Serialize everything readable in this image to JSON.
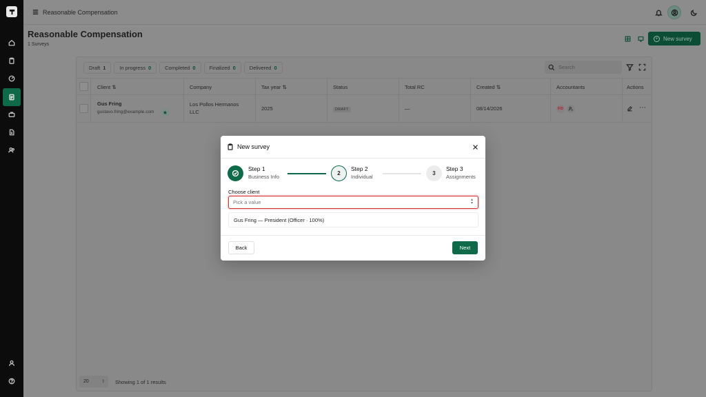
{
  "header": {
    "breadcrumb_title": "Reasonable Compensation"
  },
  "page": {
    "title": "Reasonable Compensation",
    "subtitle": "1 Surveys",
    "new_survey_label": "New survey"
  },
  "status_tabs": [
    {
      "label": "Draft",
      "count": "1"
    },
    {
      "label": "In progress",
      "count": "0"
    },
    {
      "label": "Completed",
      "count": "0"
    },
    {
      "label": "Finalized",
      "count": "0"
    },
    {
      "label": "Delivered",
      "count": "0"
    }
  ],
  "search": {
    "placeholder": "Search"
  },
  "table": {
    "columns": [
      "Client",
      "Company",
      "Tax year",
      "Status",
      "Total RC",
      "Created",
      "Accountants",
      "Actions"
    ],
    "rows": [
      {
        "client_name": "Gus Fring",
        "client_email": "gustavo.fring@example.com",
        "company_line1": "Los Pollos Hermanos",
        "company_line2": "LLC",
        "tax_year": "2025",
        "status": "DRAFT",
        "total_rc": "—",
        "created": "08/14/2026",
        "accountant_initials": "FO"
      }
    ]
  },
  "footer": {
    "page_size": "20",
    "results_text": "Showing 1 of 1 results"
  },
  "modal": {
    "title": "New survey",
    "steps": [
      {
        "number": "1",
        "title": "Step 1",
        "subtitle": "Business Info",
        "state": "done"
      },
      {
        "number": "2",
        "title": "Step 2",
        "subtitle": "Individual",
        "state": "current"
      },
      {
        "number": "3",
        "title": "Step 3",
        "subtitle": "Assignments",
        "state": "upcoming"
      }
    ],
    "field_label": "Choose client",
    "select_placeholder": "Pick a value",
    "options": [
      "Gus Fring — President (Officer · 100%)"
    ],
    "back_label": "Back",
    "next_label": "Next"
  },
  "colors": {
    "brand": "#0f6a4a",
    "error": "#d32f2f",
    "sidebar": "#0c0c0c"
  }
}
